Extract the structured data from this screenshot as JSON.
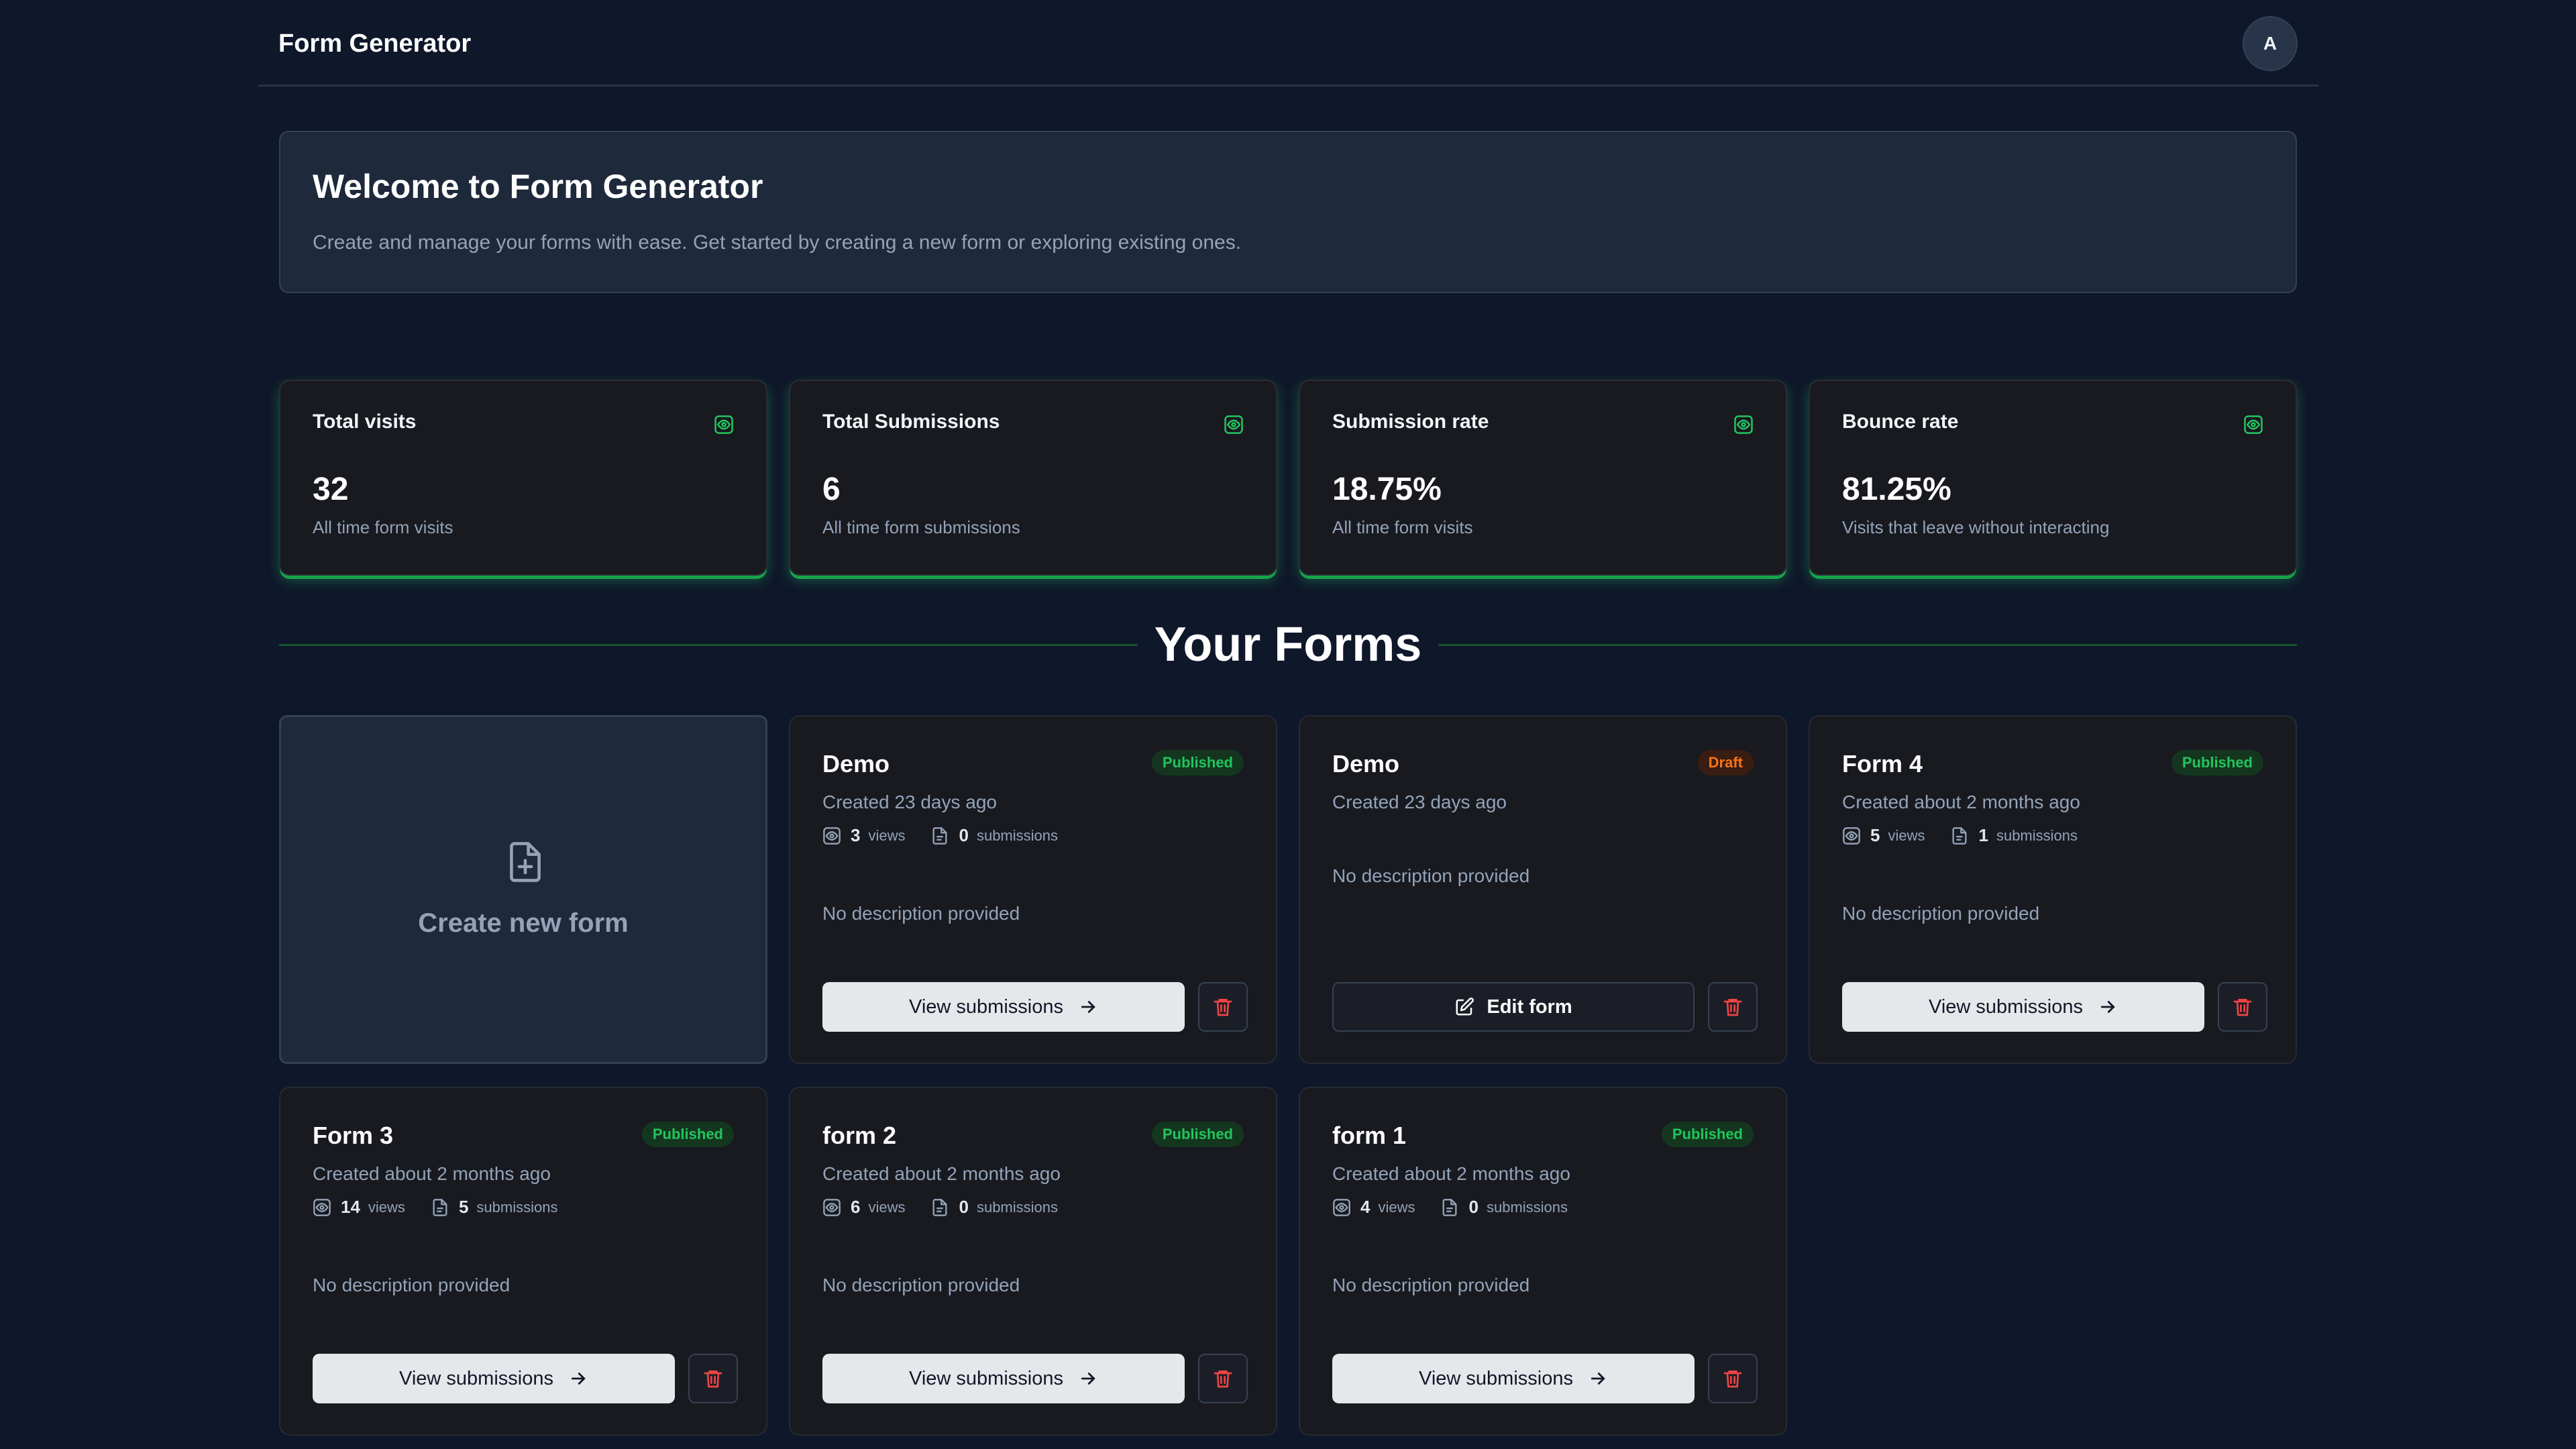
{
  "app": {
    "title": "Form Generator",
    "avatar_initial": "A"
  },
  "welcome": {
    "title": "Welcome to Form Generator",
    "subtitle": "Create and manage your forms with ease. Get started by creating a new form or exploring existing ones."
  },
  "stats": [
    {
      "title": "Total visits",
      "value": "32",
      "help": "All time form visits",
      "icon": "eye-icon"
    },
    {
      "title": "Total Submissions",
      "value": "6",
      "help": "All time form submissions",
      "icon": "eye-icon"
    },
    {
      "title": "Submission rate",
      "value": "18.75%",
      "help": "All time form visits",
      "icon": "eye-icon"
    },
    {
      "title": "Bounce rate",
      "value": "81.25%",
      "help": "Visits that leave without interacting",
      "icon": "eye-icon"
    }
  ],
  "section": {
    "title": "Your Forms"
  },
  "create_card": {
    "label": "Create new form",
    "icon": "file-plus-icon"
  },
  "labels": {
    "views": "views",
    "submissions": "submissions",
    "view_submissions": "View submissions",
    "edit_form": "Edit form"
  },
  "forms": [
    {
      "name": "Demo",
      "status": "Published",
      "created": "Created 23 days ago",
      "views": "3",
      "submissions": "0",
      "description": "No description provided"
    },
    {
      "name": "Demo",
      "status": "Draft",
      "created": "Created 23 days ago",
      "description": "No description provided"
    },
    {
      "name": "Form 4",
      "status": "Published",
      "created": "Created about 2 months ago",
      "views": "5",
      "submissions": "1",
      "description": "No description provided"
    },
    {
      "name": "Form 3",
      "status": "Published",
      "created": "Created about 2 months ago",
      "views": "14",
      "submissions": "5",
      "description": "No description provided"
    },
    {
      "name": "form 2",
      "status": "Published",
      "created": "Created about 2 months ago",
      "views": "6",
      "submissions": "0",
      "description": "No description provided"
    },
    {
      "name": "form 1",
      "status": "Published",
      "created": "Created about 2 months ago",
      "views": "4",
      "submissions": "0",
      "description": "No description provided"
    }
  ],
  "colors": {
    "background": "#0f172a",
    "card": "#181a20",
    "accent_green": "#22c55e",
    "draft_orange": "#f97316",
    "delete_red": "#ef4444"
  }
}
